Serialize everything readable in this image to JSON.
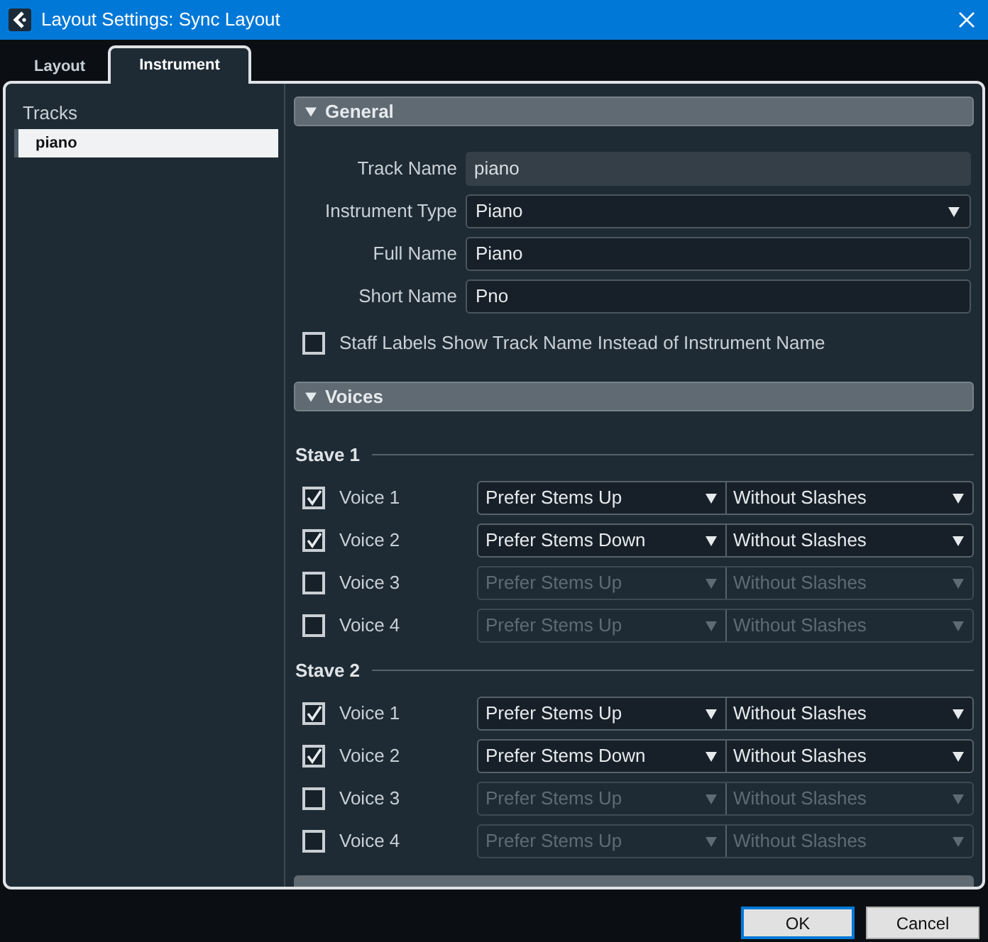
{
  "window": {
    "title": "Layout Settings: Sync Layout"
  },
  "tabs": [
    {
      "label": "Layout",
      "selected": false
    },
    {
      "label": "Instrument",
      "selected": true
    }
  ],
  "tracks": {
    "header": "Tracks",
    "items": [
      {
        "label": "piano",
        "selected": true
      }
    ]
  },
  "general": {
    "title": "General",
    "expanded": true,
    "fields": [
      {
        "label": "Track Name",
        "value": "piano",
        "kind": "readonly"
      },
      {
        "label": "Instrument Type",
        "value": "Piano",
        "kind": "dropdown"
      },
      {
        "label": "Full Name",
        "value": "Piano",
        "kind": "text"
      },
      {
        "label": "Short Name",
        "value": "Pno",
        "kind": "text"
      }
    ],
    "checkbox": {
      "label": "Staff Labels Show Track Name Instead of Instrument Name",
      "checked": false
    }
  },
  "voices": {
    "title": "Voices",
    "expanded": true,
    "staves": [
      {
        "title": "Stave 1",
        "voices": [
          {
            "label": "Voice 1",
            "checked": true,
            "stem": "Prefer Stems Up",
            "slashes": "Without Slashes"
          },
          {
            "label": "Voice 2",
            "checked": true,
            "stem": "Prefer Stems Down",
            "slashes": "Without Slashes"
          },
          {
            "label": "Voice 3",
            "checked": false,
            "stem": "Prefer Stems Up",
            "slashes": "Without Slashes"
          },
          {
            "label": "Voice 4",
            "checked": false,
            "stem": "Prefer Stems Up",
            "slashes": "Without Slashes"
          }
        ]
      },
      {
        "title": "Stave 2",
        "voices": [
          {
            "label": "Voice 1",
            "checked": true,
            "stem": "Prefer Stems Up",
            "slashes": "Without Slashes"
          },
          {
            "label": "Voice 2",
            "checked": true,
            "stem": "Prefer Stems Down",
            "slashes": "Without Slashes"
          },
          {
            "label": "Voice 3",
            "checked": false,
            "stem": "Prefer Stems Up",
            "slashes": "Without Slashes"
          },
          {
            "label": "Voice 4",
            "checked": false,
            "stem": "Prefer Stems Up",
            "slashes": "Without Slashes"
          }
        ]
      }
    ]
  },
  "buttons": [
    {
      "label": "OK",
      "default": true
    },
    {
      "label": "Cancel",
      "default": false
    }
  ]
}
